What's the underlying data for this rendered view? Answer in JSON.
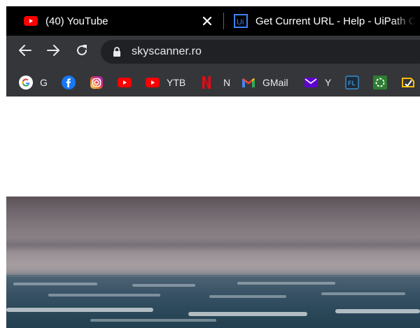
{
  "browser": {
    "tabs": [
      {
        "title": "(40) YouTube",
        "favicon": "youtube-icon",
        "active": true
      },
      {
        "title": "Get Current URL - Help - UiPath C",
        "favicon": "uipath-icon",
        "active": false
      }
    ],
    "close_glyph": "✕",
    "address_bar": {
      "url": "skyscanner.ro"
    },
    "bookmarks": [
      {
        "label": "G",
        "icon": "google-icon"
      },
      {
        "label": "",
        "icon": "facebook-icon"
      },
      {
        "label": "",
        "icon": "instagram-icon"
      },
      {
        "label": "",
        "icon": "youtube-icon"
      },
      {
        "label": "YTB",
        "icon": "youtube-icon"
      },
      {
        "label": "N",
        "icon": "netflix-icon"
      },
      {
        "label": "GMail",
        "icon": "gmail-icon"
      },
      {
        "label": "Y",
        "icon": "yahoo-mail-icon"
      },
      {
        "label": "",
        "icon": "fl-icon"
      },
      {
        "label": "",
        "icon": "green-circle-icon"
      },
      {
        "label": "",
        "icon": "extension-icon"
      }
    ]
  },
  "colors": {
    "tabstrip_bg": "#000000",
    "toolbar_bg": "#35363a",
    "omnibox_bg": "#202124",
    "youtube_red": "#ff0000",
    "netflix_red": "#e50914",
    "uipath_blue": "#3b82f6"
  },
  "page": {
    "hero_image": "sea horizon with overcast sky"
  }
}
